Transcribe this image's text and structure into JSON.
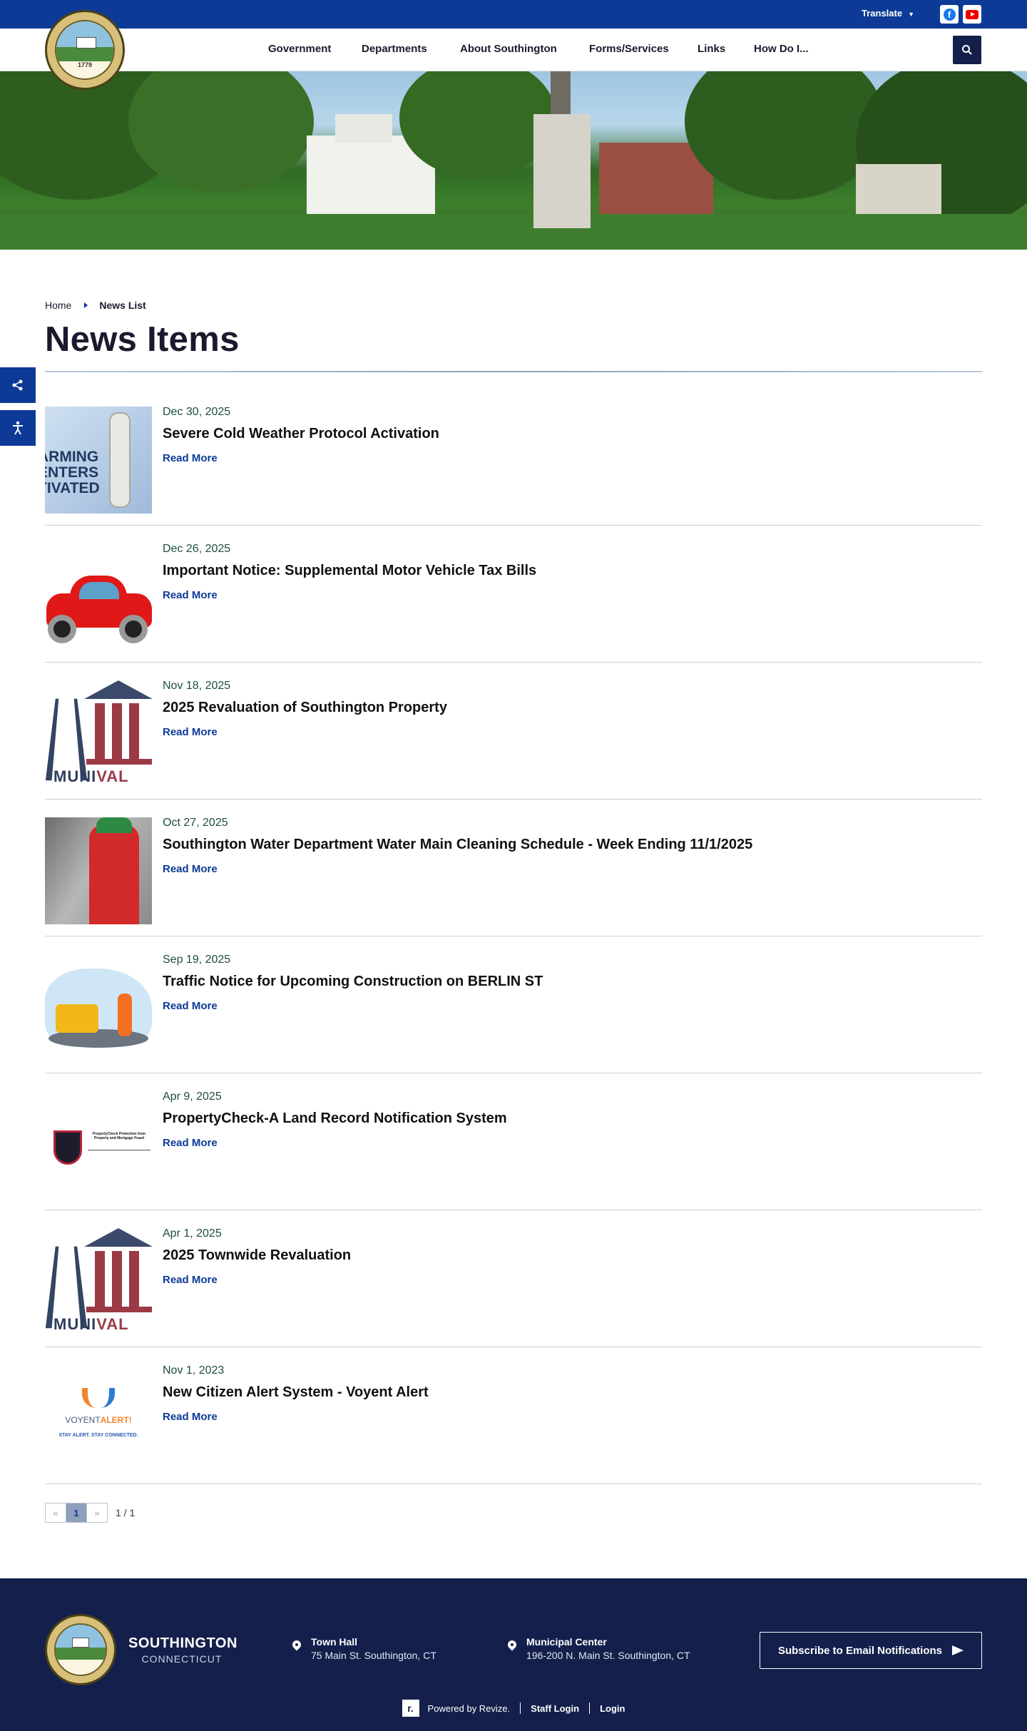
{
  "topbar": {
    "translate_label": "Translate",
    "brand_color": "#0c3a96"
  },
  "nav": {
    "items": [
      "Government",
      "Departments",
      "About Southington",
      "Forms/Services",
      "Links",
      "How Do I..."
    ]
  },
  "seal": {
    "year": "1779"
  },
  "breadcrumb": {
    "home": "Home",
    "current": "News List"
  },
  "page": {
    "title": "News Items"
  },
  "news": [
    {
      "date": "Dec 30, 2025",
      "title": "Severe Cold Weather Protocol Activation",
      "read_more": "Read More",
      "thumb_text": "ARMING\nENTERS\nTIVATED"
    },
    {
      "date": "Dec 26, 2025",
      "title": "Important Notice: Supplemental Motor Vehicle Tax Bills",
      "read_more": "Read More"
    },
    {
      "date": "Nov 18, 2025",
      "title": "2025 Revaluation of Southington Property",
      "read_more": "Read More",
      "thumb_text_a": "MUNI",
      "thumb_text_b": "VAL"
    },
    {
      "date": "Oct 27, 2025",
      "title": "Southington Water Department Water Main Cleaning Schedule - Week Ending 11/1/2025",
      "read_more": "Read More"
    },
    {
      "date": "Sep 19, 2025",
      "title": "Traffic Notice for Upcoming Construction on BERLIN ST",
      "read_more": "Read More"
    },
    {
      "date": "Apr 9, 2025",
      "title": "PropertyCheck-A Land Record Notification System",
      "read_more": "Read More",
      "thumb_text": "PropertyCheck Protection from Property and Mortgage Fraud"
    },
    {
      "date": "Apr 1, 2025",
      "title": "2025 Townwide Revaluation",
      "read_more": "Read More",
      "thumb_text_a": "MUNI",
      "thumb_text_b": "VAL"
    },
    {
      "date": "Nov 1, 2023",
      "title": "New Citizen Alert System - Voyent Alert",
      "read_more": "Read More",
      "thumb_text_a": "VOYENT",
      "thumb_text_b": "ALERT!",
      "thumb_tag": "STAY ALERT. STAY CONNECTED."
    }
  ],
  "pagination": {
    "prev": "«",
    "current": "1",
    "next": "»",
    "count": "1 / 1"
  },
  "footer": {
    "town_name": "SOUTHINGTON",
    "town_state": "CONNECTICUT",
    "locations": [
      {
        "name": "Town Hall",
        "address": "75 Main St. Southington, CT"
      },
      {
        "name": "Municipal Center",
        "address": "196-200 N. Main St. Southington, CT"
      }
    ],
    "subscribe_label": "Subscribe to Email Notifications",
    "powered_by": "Powered by Revize.",
    "revize_mark": "r.",
    "staff_login": "Staff Login",
    "login": "Login",
    "background_color": "#14204b"
  }
}
